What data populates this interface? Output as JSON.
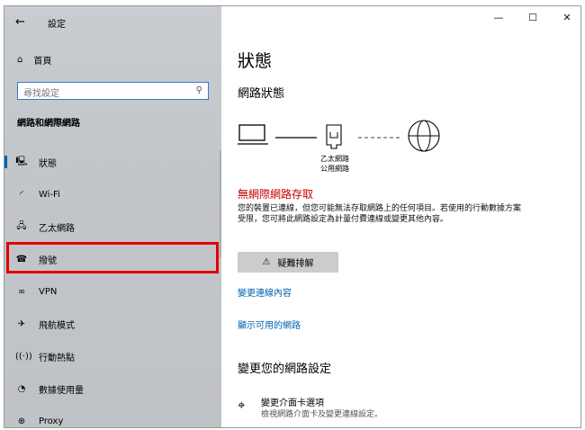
{
  "window": {
    "title": "設定",
    "controls": {
      "minimize": "—",
      "maximize": "☐",
      "close": "✕"
    }
  },
  "sidebar": {
    "back_icon": "←",
    "home_icon": "⌂",
    "home_label": "首頁",
    "search_placeholder": "尋找設定",
    "search_icon": "⚲",
    "section_heading": "網路和網際網路",
    "items": [
      {
        "icon": "🖳",
        "label": "狀態",
        "active": true
      },
      {
        "icon": "◜",
        "label": "Wi-Fi"
      },
      {
        "icon": "🖧",
        "label": "乙太網路"
      },
      {
        "icon": "☎",
        "label": "撥號"
      },
      {
        "icon": "∞",
        "label": "VPN"
      },
      {
        "icon": "✈",
        "label": "飛航模式"
      },
      {
        "icon": "((·))",
        "label": "行動熱點"
      },
      {
        "icon": "◔",
        "label": "數據使用量"
      },
      {
        "icon": "⊕",
        "label": "Proxy"
      }
    ]
  },
  "main": {
    "title": "狀態",
    "network_status_heading": "網路狀態",
    "adapter_label": "乙太網路",
    "network_label": "公用網路",
    "error_title": "無網際網路存取",
    "error_desc": "您的裝置已連線，但您可能無法存取網路上的任何項目。若使用的行動數據方案受限，您可將此網路設定為計量付費連線或變更其他內容。",
    "troubleshoot_icon": "⚠",
    "troubleshoot_label": "疑難排解",
    "links": {
      "change_connection": "變更連線內容",
      "show_networks": "顯示可用的網路"
    },
    "change_heading": "變更您的網路設定",
    "option": {
      "icon": "⌖",
      "title": "變更介面卡選項",
      "desc": "檢視網路介面卡及變更連線設定。"
    }
  }
}
